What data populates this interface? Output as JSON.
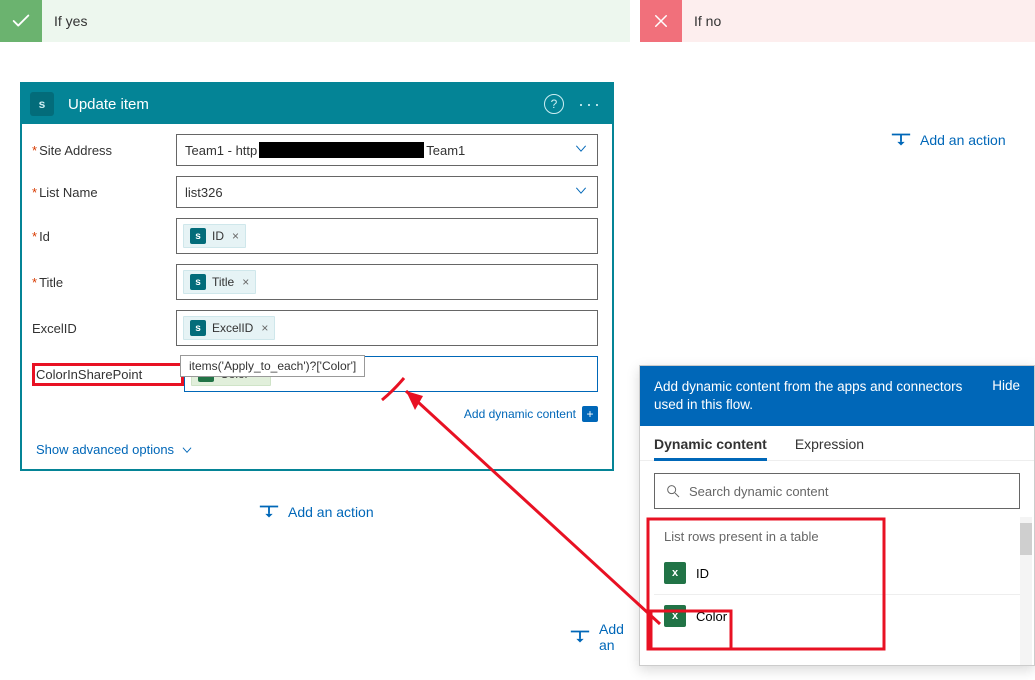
{
  "branches": {
    "yes_label": "If yes",
    "no_label": "If no"
  },
  "card": {
    "title": "Update item",
    "fields": {
      "site_address": {
        "label": "Site Address",
        "value_prefix": "Team1 - http",
        "value_suffix": "Team1"
      },
      "list_name": {
        "label": "List Name",
        "value": "list326"
      },
      "id": {
        "label": "Id",
        "tokens": [
          {
            "source": "sharepoint",
            "text": "ID"
          }
        ]
      },
      "title": {
        "label": "Title",
        "tokens": [
          {
            "source": "sharepoint",
            "text": "Title"
          }
        ]
      },
      "excel_id": {
        "label": "ExcelID",
        "tokens": [
          {
            "source": "sharepoint",
            "text": "ExcelID"
          }
        ]
      },
      "color_sp": {
        "label": "ColorInSharePoint",
        "tokens": [
          {
            "source": "excel",
            "text": "Color"
          }
        ]
      }
    },
    "tooltip_expression": "items('Apply_to_each')?['Color']",
    "add_dynamic_label": "Add dynamic content",
    "show_advanced_label": "Show advanced options"
  },
  "add_action_label": "Add an action",
  "add_action_label_cut": "Add an",
  "dyn_panel": {
    "header_text": "Add dynamic content from the apps and connectors used in this flow.",
    "hide_label": "Hide",
    "tabs": {
      "dc": "Dynamic content",
      "expr": "Expression"
    },
    "search_placeholder": "Search dynamic content",
    "section_title": "List rows present in a table",
    "items": [
      {
        "source": "excel",
        "text": "ID"
      },
      {
        "source": "excel",
        "text": "Color"
      }
    ]
  },
  "icons": {
    "sp_chip_letter": "s",
    "xl_chip_letter": "x"
  }
}
